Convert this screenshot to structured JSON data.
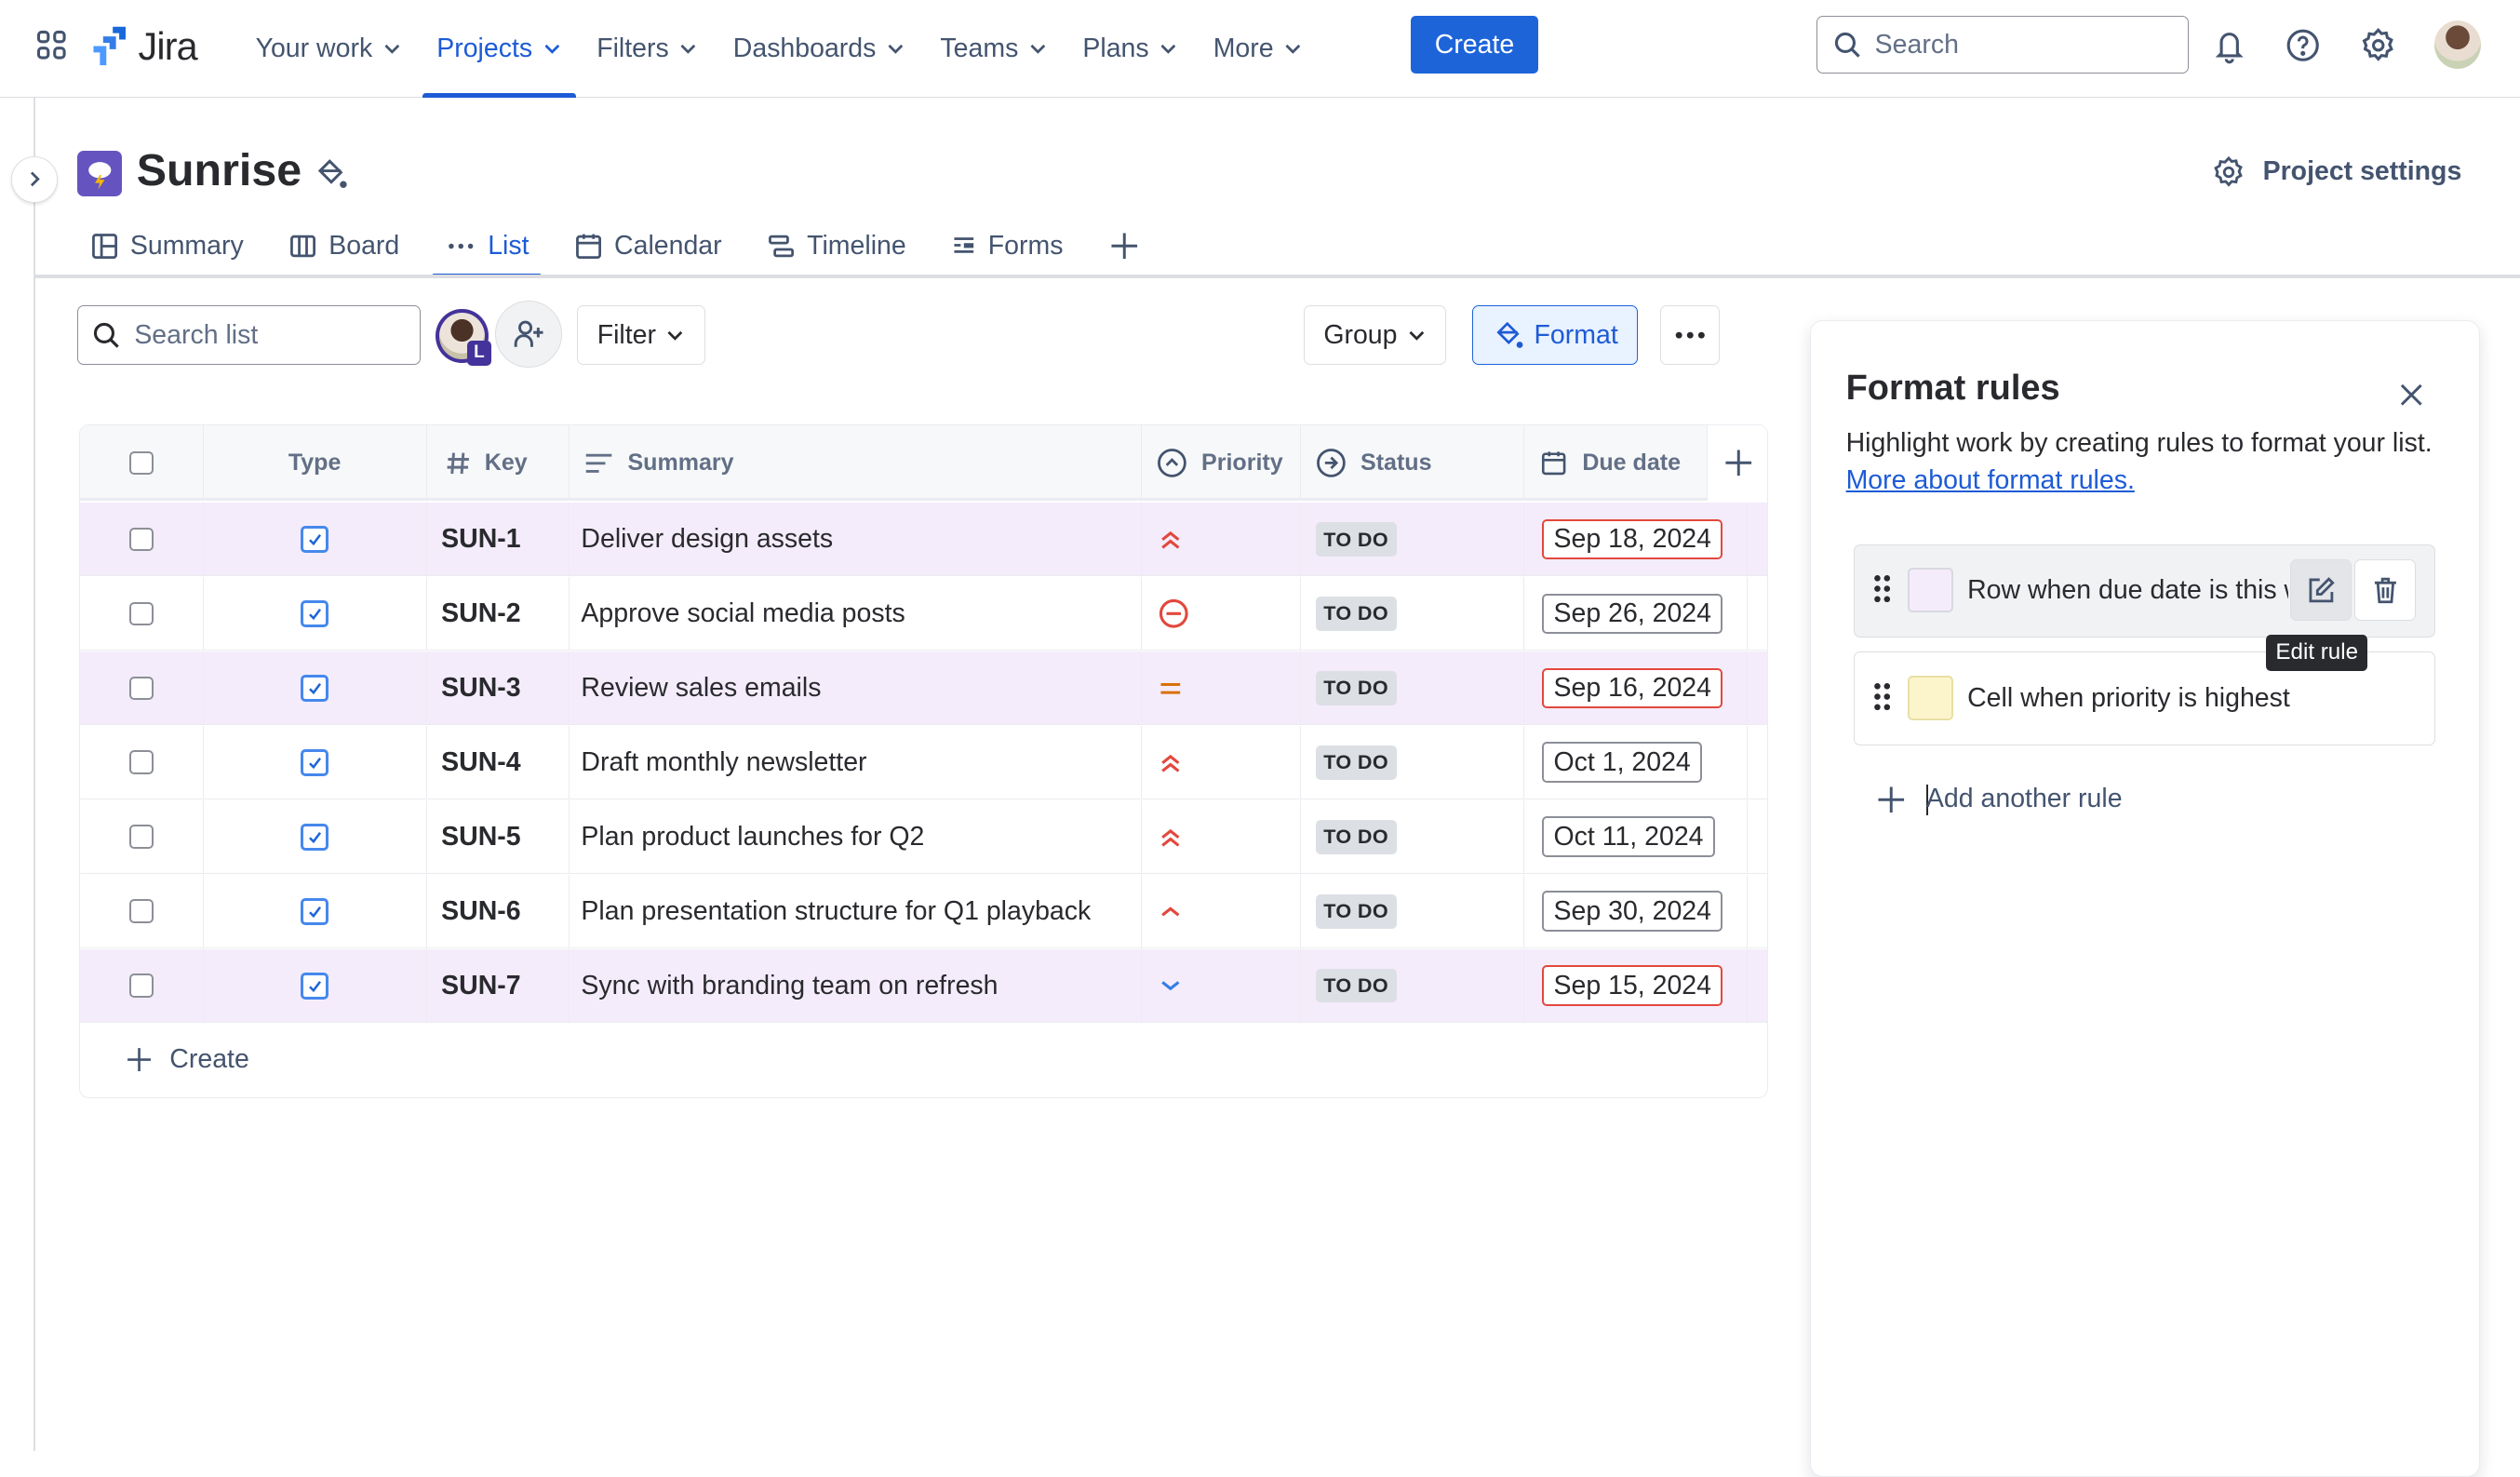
{
  "topnav": {
    "app_name": "Jira",
    "items": [
      {
        "label": "Your work",
        "active": false
      },
      {
        "label": "Projects",
        "active": true
      },
      {
        "label": "Filters",
        "active": false
      },
      {
        "label": "Dashboards",
        "active": false
      },
      {
        "label": "Teams",
        "active": false
      },
      {
        "label": "Plans",
        "active": false
      },
      {
        "label": "More",
        "active": false
      }
    ],
    "create_label": "Create",
    "search_placeholder": "Search",
    "icons": [
      "app-switcher-icon",
      "notifications-icon",
      "help-icon",
      "settings-icon"
    ]
  },
  "project": {
    "name": "Sunrise",
    "settings_label": "Project settings"
  },
  "tabs": [
    {
      "label": "Summary",
      "icon": "summary-icon",
      "active": false
    },
    {
      "label": "Board",
      "icon": "board-icon",
      "active": false
    },
    {
      "label": "List",
      "icon": "more-dots-icon",
      "active": true
    },
    {
      "label": "Calendar",
      "icon": "calendar-icon",
      "active": false
    },
    {
      "label": "Timeline",
      "icon": "timeline-icon",
      "active": false
    },
    {
      "label": "Forms",
      "icon": "forms-icon",
      "active": false
    }
  ],
  "toolbar": {
    "search_placeholder": "Search list",
    "avatar_badge": "L",
    "filter_label": "Filter",
    "group_label": "Group",
    "format_label": "Format"
  },
  "table": {
    "columns": {
      "type": "Type",
      "key": "Key",
      "summary": "Summary",
      "priority": "Priority",
      "status": "Status",
      "due": "Due date"
    },
    "rows": [
      {
        "key": "SUN-1",
        "summary": "Deliver design assets",
        "priority": "highest",
        "status": "TO DO",
        "due": "Sep 18, 2024",
        "overdue": true,
        "highlighted": true
      },
      {
        "key": "SUN-2",
        "summary": "Approve social media posts",
        "priority": "blocker",
        "status": "TO DO",
        "due": "Sep 26, 2024",
        "overdue": false,
        "highlighted": false
      },
      {
        "key": "SUN-3",
        "summary": "Review sales emails",
        "priority": "medium",
        "status": "TO DO",
        "due": "Sep 16, 2024",
        "overdue": true,
        "highlighted": true
      },
      {
        "key": "SUN-4",
        "summary": "Draft monthly newsletter",
        "priority": "highest",
        "status": "TO DO",
        "due": "Oct 1, 2024",
        "overdue": false,
        "highlighted": false
      },
      {
        "key": "SUN-5",
        "summary": "Plan product launches for Q2",
        "priority": "highest",
        "status": "TO DO",
        "due": "Oct 11, 2024",
        "overdue": false,
        "highlighted": false
      },
      {
        "key": "SUN-6",
        "summary": "Plan presentation structure for Q1 playback",
        "priority": "high",
        "status": "TO DO",
        "due": "Sep 30, 2024",
        "overdue": false,
        "highlighted": false
      },
      {
        "key": "SUN-7",
        "summary": "Sync with branding team on refresh",
        "priority": "low",
        "status": "TO DO",
        "due": "Sep 15, 2024",
        "overdue": true,
        "highlighted": true
      }
    ],
    "create_label": "Create"
  },
  "format_panel": {
    "title": "Format rules",
    "description": "Highlight work by creating rules to format your list.",
    "link_text": "More about format rules.",
    "rules": [
      {
        "text": "Row when due date is this week",
        "color": "#f4ecfb"
      },
      {
        "text": "Cell when priority is highest",
        "color": "#fcf5cc"
      }
    ],
    "tooltip": "Edit rule",
    "add_label": "Add another rule"
  },
  "colors": {
    "accent": "#1d64d9",
    "highlight_row": "#f4ecfb",
    "priority_red": "#e2483d",
    "priority_orange": "#d97008",
    "priority_blue": "#357de8"
  }
}
